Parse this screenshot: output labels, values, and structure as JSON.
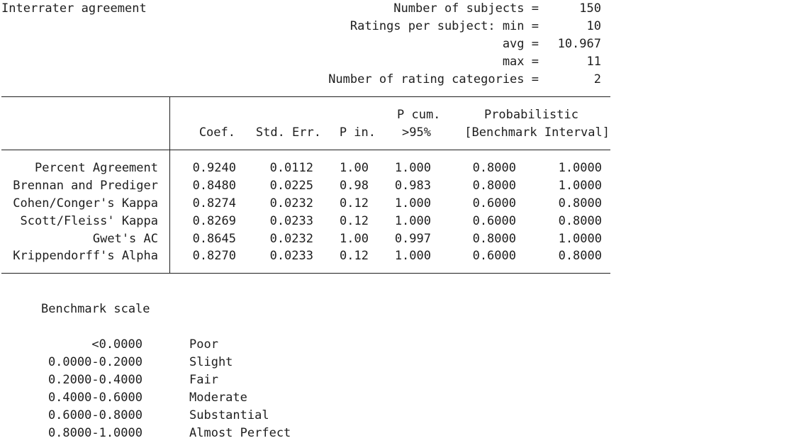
{
  "title": "Interrater agreement",
  "summary": [
    {
      "label": "Number of subjects =",
      "value": "150"
    },
    {
      "label": "Ratings per subject: min =",
      "value": "10"
    },
    {
      "label": "avg =",
      "value": "10.967"
    },
    {
      "label": "max =",
      "value": "11"
    },
    {
      "label": "Number of rating categories =",
      "value": "2"
    }
  ],
  "table": {
    "headers": {
      "coef": "Coef.",
      "stderr": "Std. Err.",
      "pin": "P in.",
      "pcum_top": "P cum.",
      "pcum_bottom": ">95%",
      "prob_top": "Probabilistic",
      "prob_bottom": "[Benchmark Interval]"
    },
    "rows": [
      {
        "name": "Percent Agreement",
        "coef": "0.9240",
        "se": "0.0112",
        "pin": "1.00",
        "pcum": "1.000",
        "lo": "0.8000",
        "hi": "1.0000"
      },
      {
        "name": "Brennan and Prediger",
        "coef": "0.8480",
        "se": "0.0225",
        "pin": "0.98",
        "pcum": "0.983",
        "lo": "0.8000",
        "hi": "1.0000"
      },
      {
        "name": "Cohen/Conger's Kappa",
        "coef": "0.8274",
        "se": "0.0232",
        "pin": "0.12",
        "pcum": "1.000",
        "lo": "0.6000",
        "hi": "0.8000"
      },
      {
        "name": "Scott/Fleiss' Kappa",
        "coef": "0.8269",
        "se": "0.0233",
        "pin": "0.12",
        "pcum": "1.000",
        "lo": "0.6000",
        "hi": "0.8000"
      },
      {
        "name": "Gwet's AC",
        "coef": "0.8645",
        "se": "0.0232",
        "pin": "1.00",
        "pcum": "0.997",
        "lo": "0.8000",
        "hi": "1.0000"
      },
      {
        "name": "Krippendorff's Alpha",
        "coef": "0.8270",
        "se": "0.0233",
        "pin": "0.12",
        "pcum": "1.000",
        "lo": "0.6000",
        "hi": "0.8000"
      }
    ]
  },
  "benchmark": {
    "title": "Benchmark scale",
    "rows": [
      {
        "range": "<0.0000",
        "label": "Poor"
      },
      {
        "range": "0.0000-0.2000",
        "label": "Slight"
      },
      {
        "range": "0.2000-0.4000",
        "label": "Fair"
      },
      {
        "range": "0.4000-0.6000",
        "label": "Moderate"
      },
      {
        "range": "0.6000-0.8000",
        "label": "Substantial"
      },
      {
        "range": "0.8000-1.0000",
        "label": "Almost Perfect"
      }
    ]
  }
}
